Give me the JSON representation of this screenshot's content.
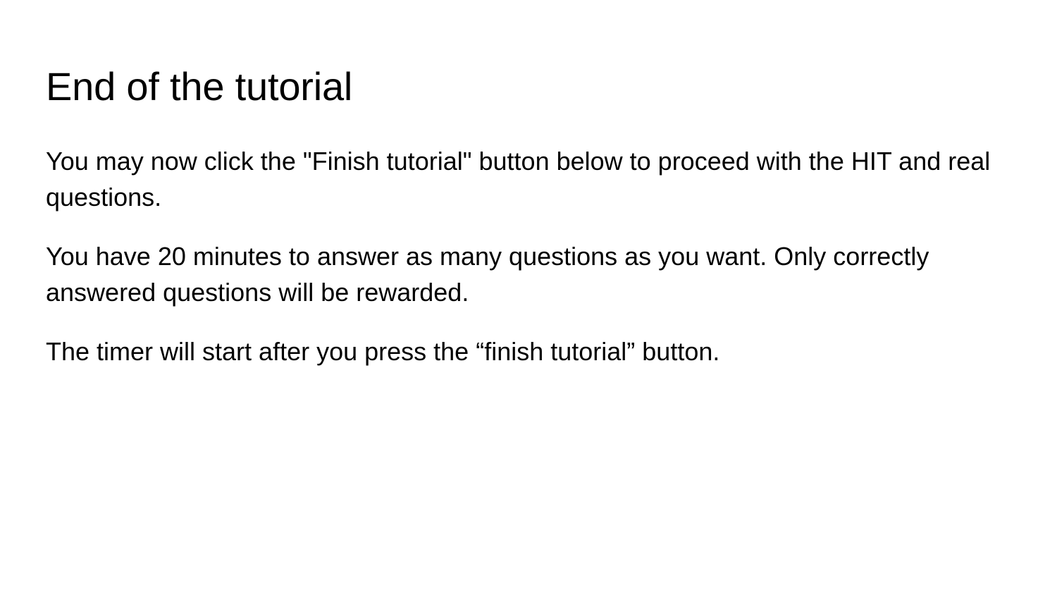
{
  "slide": {
    "title": "End of the tutorial",
    "paragraphs": [
      "You may now click the \"Finish tutorial\" button below to proceed with the HIT and real questions.",
      "You have 20 minutes to answer as many questions as you want. Only correctly answered questions will be rewarded.",
      "The timer will start after you press the “finish tutorial” button."
    ]
  },
  "colors": {
    "background": "#ffffff",
    "text": "#000000"
  }
}
